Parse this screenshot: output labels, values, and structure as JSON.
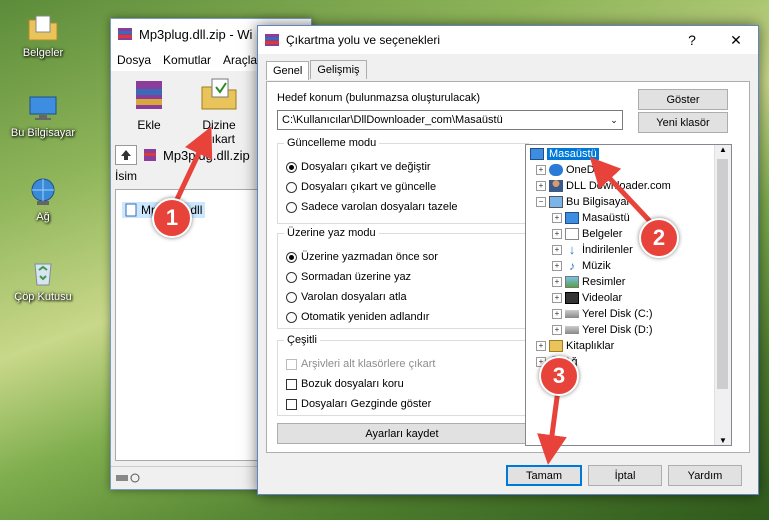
{
  "desktop": {
    "icons": [
      {
        "label": "Belgeler"
      },
      {
        "label": "Bu Bilgisayar"
      },
      {
        "label": "Ağ"
      },
      {
        "label": "Çöp Kutusu"
      }
    ]
  },
  "winrar": {
    "title": "Mp3plug.dll.zip - Wi",
    "menu": [
      "Dosya",
      "Komutlar",
      "Araçla"
    ],
    "tools": {
      "add": "Ekle",
      "extract": "Dizine Çıkart"
    },
    "path": "Mp3plug.dll.zip",
    "column_name": "İsim",
    "file": "Mp3plug.dll"
  },
  "dialog": {
    "title": "Çıkartma yolu ve seçenekleri",
    "tabs": [
      "Genel",
      "Gelişmiş"
    ],
    "dest_label": "Hedef konum (bulunmazsa oluşturulacak)",
    "dest_value": "C:\\Kullanıcılar\\DllDownloader_com\\Masaüstü",
    "show_button": "Göster",
    "new_folder_button": "Yeni klasör",
    "update_mode": {
      "legend": "Güncelleme modu",
      "options": [
        "Dosyaları çıkart ve değiştir",
        "Dosyaları çıkart ve güncelle",
        "Sadece varolan dosyaları tazele"
      ],
      "selected": 0
    },
    "overwrite_mode": {
      "legend": "Üzerine yaz modu",
      "options": [
        "Üzerine yazmadan önce sor",
        "Sormadan üzerine yaz",
        "Varolan dosyaları atla",
        "Otomatik yeniden adlandır"
      ],
      "selected": 0
    },
    "misc": {
      "legend": "Çeşitli",
      "options": [
        "Arşivleri alt klasörlere çıkart",
        "Bozuk dosyaları koru",
        "Dosyaları Gezginde göster"
      ]
    },
    "save_settings": "Ayarları kaydet",
    "tree": [
      {
        "label": "Masaüstü",
        "level": 0,
        "selected": true,
        "icon": "desktop-icon"
      },
      {
        "label": "OneDrive",
        "level": 1,
        "icon": "cloud-icon"
      },
      {
        "label": "DLL Downloader.com",
        "level": 1,
        "icon": "user-icon"
      },
      {
        "label": "Bu Bilgisayar",
        "level": 1,
        "icon": "computer-icon"
      },
      {
        "label": "Masaüstü",
        "level": 2,
        "icon": "desktop-icon"
      },
      {
        "label": "Belgeler",
        "level": 2,
        "icon": "documents-icon"
      },
      {
        "label": "İndirilenler",
        "level": 2,
        "icon": "download-icon"
      },
      {
        "label": "Müzik",
        "level": 2,
        "icon": "music-icon"
      },
      {
        "label": "Resimler",
        "level": 2,
        "icon": "pictures-icon"
      },
      {
        "label": "Videolar",
        "level": 2,
        "icon": "video-icon"
      },
      {
        "label": "Yerel Disk (C:)",
        "level": 2,
        "icon": "drive-icon"
      },
      {
        "label": "Yerel Disk (D:)",
        "level": 2,
        "icon": "drive-icon"
      },
      {
        "label": "Kitaplıklar",
        "level": 1,
        "icon": "library-icon"
      },
      {
        "label": "Ağ",
        "level": 1,
        "icon": "network-icon"
      }
    ],
    "ok": "Tamam",
    "cancel": "İptal",
    "help": "Yardım"
  },
  "callouts": [
    "1",
    "2",
    "3"
  ],
  "colors": {
    "accent": "#0078d7",
    "callout": "#e8433b"
  }
}
